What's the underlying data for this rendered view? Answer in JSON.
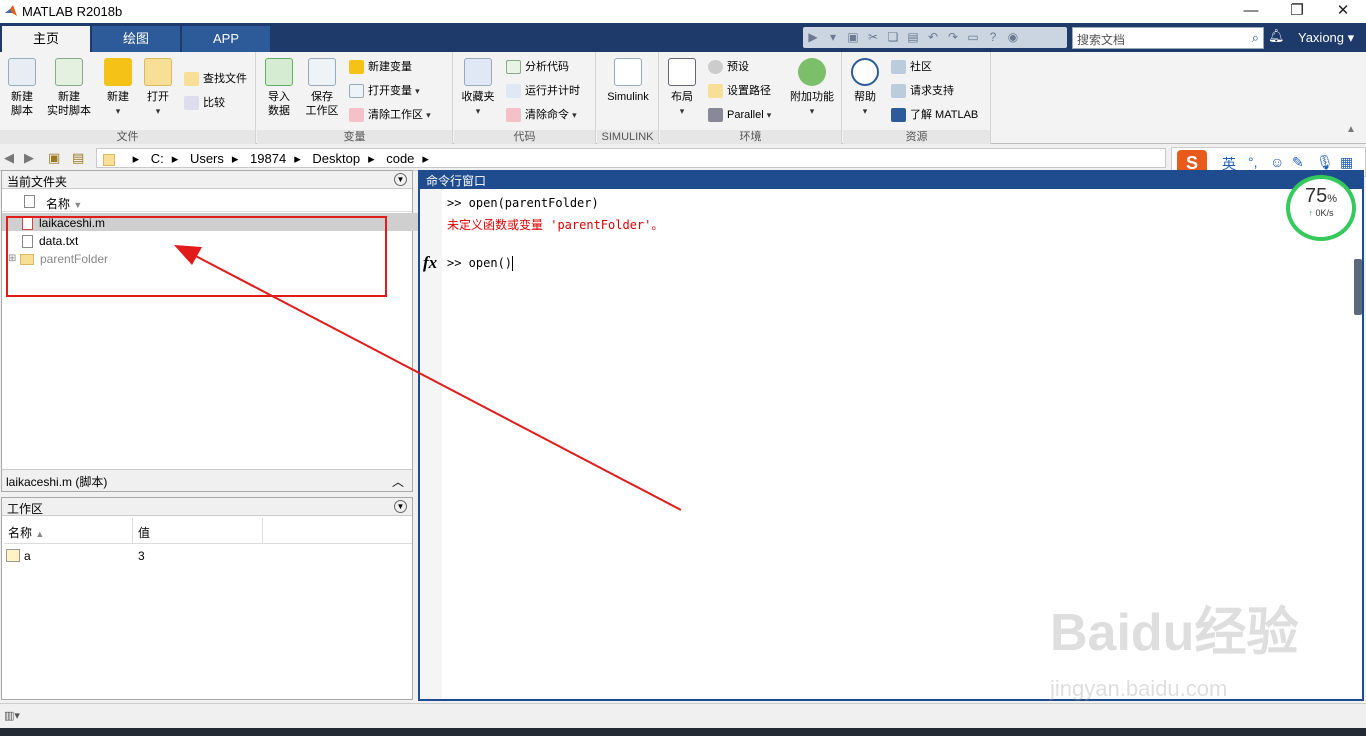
{
  "window": {
    "title": "MATLAB R2018b"
  },
  "tabs": [
    {
      "label": "主页"
    },
    {
      "label": "绘图"
    },
    {
      "label": "APP"
    }
  ],
  "search": {
    "placeholder": "搜索文档"
  },
  "user": {
    "name": "Yaxiong"
  },
  "ribbon": {
    "file_group": {
      "label": "文件",
      "new_script": "新建\n脚本",
      "new_live_script": "新建\n实时脚本",
      "new": "新建",
      "open": "打开",
      "find_files": "查找文件",
      "compare": "比较"
    },
    "variable_group": {
      "label": "变量",
      "import_data": "导入\n数据",
      "save_workspace": "保存\n工作区",
      "new_variable": "新建变量",
      "open_variable": "打开变量",
      "clear_workspace": "清除工作区"
    },
    "code_group": {
      "label": "代码",
      "favorites": "收藏夹",
      "analyze_code": "分析代码",
      "run_and_time": "运行并计时",
      "clear_commands": "清除命令"
    },
    "simulink_group": {
      "label": "SIMULINK",
      "simulink": "Simulink"
    },
    "environment_group": {
      "label": "环境",
      "layout": "布局",
      "preferences": "预设",
      "set_path": "设置路径",
      "parallel": "Parallel",
      "addons": "附加功能"
    },
    "resources_group": {
      "label": "资源",
      "help": "帮助",
      "community": "社区",
      "request_support": "请求支持",
      "learn_matlab": "了解 MATLAB"
    }
  },
  "address": {
    "path": [
      "C:",
      "Users",
      "19874",
      "Desktop",
      "code"
    ]
  },
  "ime": {
    "lang": "英"
  },
  "current_folder": {
    "title": "当前文件夹",
    "column_name": "名称",
    "files": [
      {
        "name": "laikaceshi.m"
      },
      {
        "name": "data.txt"
      },
      {
        "name": "parentFolder"
      }
    ],
    "details": "laikaceshi.m  (脚本)"
  },
  "workspace": {
    "title": "工作区",
    "columns": [
      "名称",
      "值"
    ],
    "rows": [
      {
        "name": "a",
        "value": "3"
      }
    ]
  },
  "command_window": {
    "title": "命令行窗口",
    "lines": [
      {
        "text": ">> open(parentFolder)"
      },
      {
        "text": "未定义函数或变量 'parentFolder'。"
      },
      {
        "text": ">> open()"
      }
    ],
    "fx": "fx"
  },
  "speed_widget": {
    "percent": "75",
    "unit": "%",
    "rate": "0K/s"
  },
  "watermark": {
    "text": "Baidu经验",
    "url": "jingyan.baidu.com"
  },
  "colors": {
    "tab_bar": "#1d3a6a",
    "command_header": "#1f4c8e",
    "error_text": "#e00000",
    "annotation": "#e21b1b"
  }
}
